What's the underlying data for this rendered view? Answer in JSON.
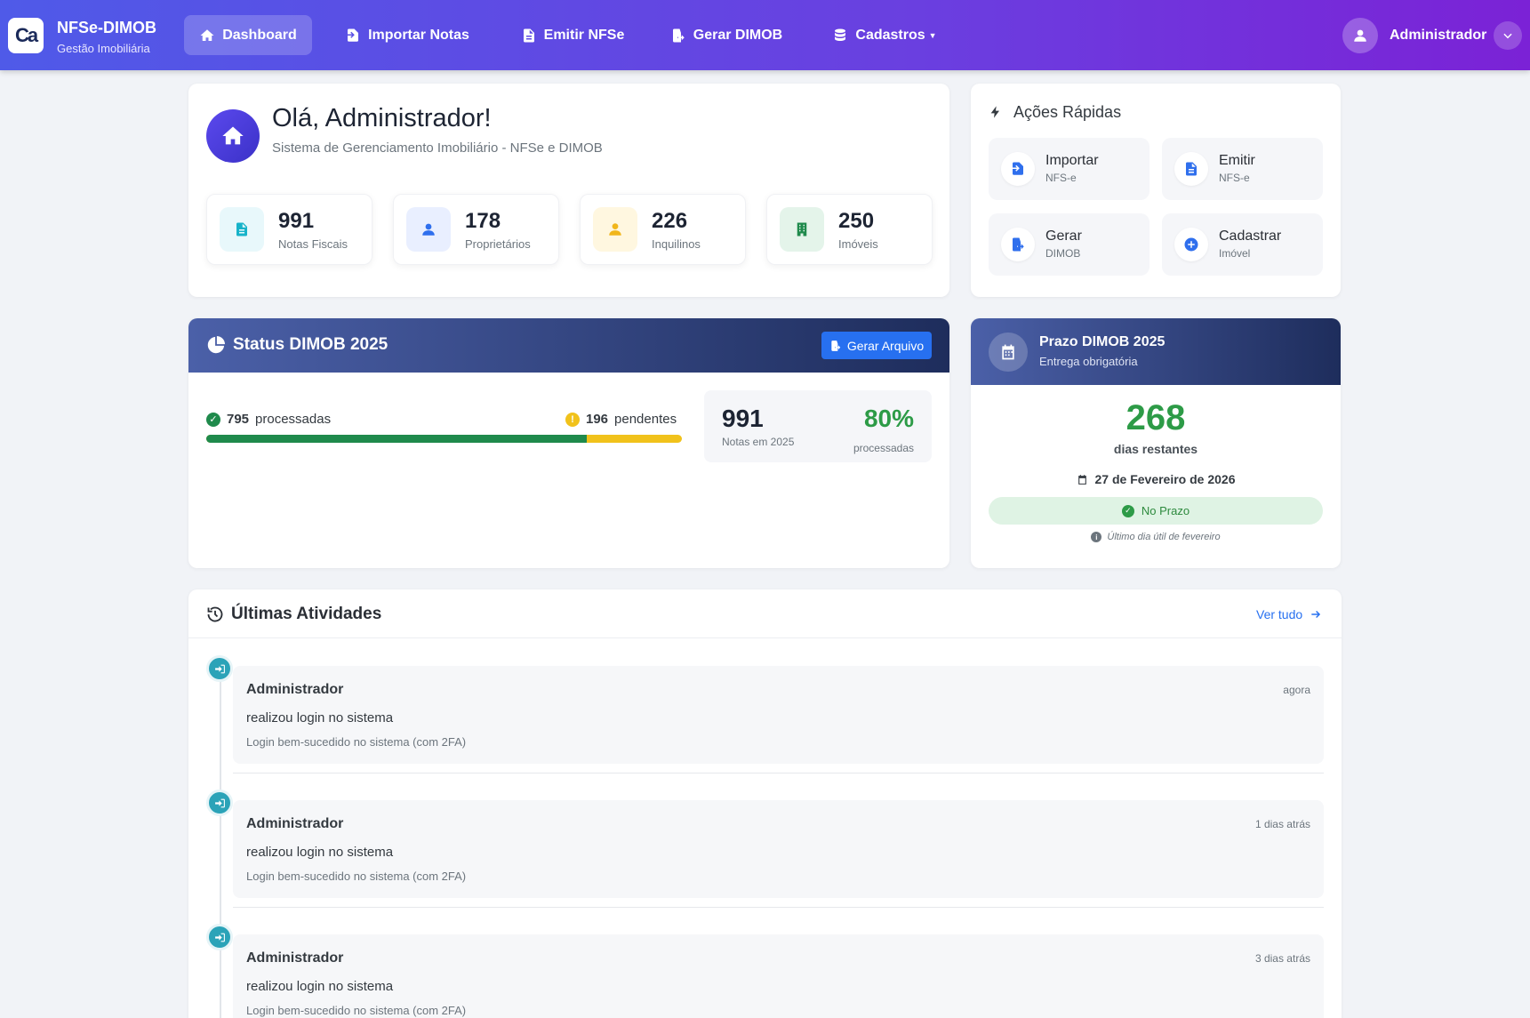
{
  "brand": {
    "logo_text": "Ca",
    "title": "NFSe-DIMOB",
    "subtitle": "Gestão Imobiliária"
  },
  "nav": {
    "items": [
      {
        "label": "Dashboard",
        "icon": "home-icon",
        "active": true
      },
      {
        "label": "Importar Notas",
        "icon": "file-import-icon",
        "active": false
      },
      {
        "label": "Emitir NFSe",
        "icon": "file-text-icon",
        "active": false
      },
      {
        "label": "Gerar DIMOB",
        "icon": "file-export-icon",
        "active": false
      },
      {
        "label": "Cadastros",
        "icon": "database-icon",
        "active": false,
        "dropdown": true
      }
    ],
    "user_name": "Administrador"
  },
  "welcome": {
    "title": "Olá, Administrador!",
    "subtitle": "Sistema de Gerenciamento Imobiliário - NFSe e DIMOB",
    "stats": [
      {
        "value": "991",
        "label": "Notas Fiscais",
        "icon": "file-invoice-icon",
        "color": "#17b3c9",
        "bg": "#e8f8fb"
      },
      {
        "value": "178",
        "label": "Proprietários",
        "icon": "user-icon",
        "color": "#2f6fed",
        "bg": "#e9efff"
      },
      {
        "value": "226",
        "label": "Inquilinos",
        "icon": "user-tie-icon",
        "color": "#f1b61b",
        "bg": "#fff7e0"
      },
      {
        "value": "250",
        "label": "Imóveis",
        "icon": "building-icon",
        "color": "#1f8a4c",
        "bg": "#e4f4ea"
      }
    ]
  },
  "quick_actions": {
    "title": "Ações Rápidas",
    "items": [
      {
        "main": "Importar",
        "sub": "NFS-e",
        "icon": "file-import-icon"
      },
      {
        "main": "Emitir",
        "sub": "NFS-e",
        "icon": "file-text-icon"
      },
      {
        "main": "Gerar",
        "sub": "DIMOB",
        "icon": "file-export-icon"
      },
      {
        "main": "Cadastrar",
        "sub": "Imóvel",
        "icon": "plus-circle-icon"
      }
    ]
  },
  "status": {
    "title": "Status DIMOB 2025",
    "button": "Gerar Arquivo",
    "processed_count": "795",
    "processed_label": "processadas",
    "pending_count": "196",
    "pending_label": "pendentes",
    "processed_fraction": 0.8,
    "total": "991",
    "total_label": "Notas em 2025",
    "percent": "80%",
    "percent_label": "processadas",
    "colors": {
      "processed": "#1f8a4c",
      "pending": "#f1c21b"
    }
  },
  "prazo": {
    "title": "Prazo DIMOB 2025",
    "subtitle": "Entrega obrigatória",
    "days": "268",
    "days_label": "dias restantes",
    "deadline": "27 de Fevereiro de 2026",
    "badge": "No Prazo",
    "note": "Último dia útil de fevereiro"
  },
  "activities": {
    "title": "Últimas Atividades",
    "see_all": "Ver tudo",
    "items": [
      {
        "user": "Administrador",
        "time": "agora",
        "action": "realizou login no sistema",
        "detail": "Login bem-sucedido no sistema (com 2FA)"
      },
      {
        "user": "Administrador",
        "time": "1 dias atrás",
        "action": "realizou login no sistema",
        "detail": "Login bem-sucedido no sistema (com 2FA)"
      },
      {
        "user": "Administrador",
        "time": "3 dias atrás",
        "action": "realizou login no sistema",
        "detail": "Login bem-sucedido no sistema (com 2FA)"
      }
    ]
  }
}
